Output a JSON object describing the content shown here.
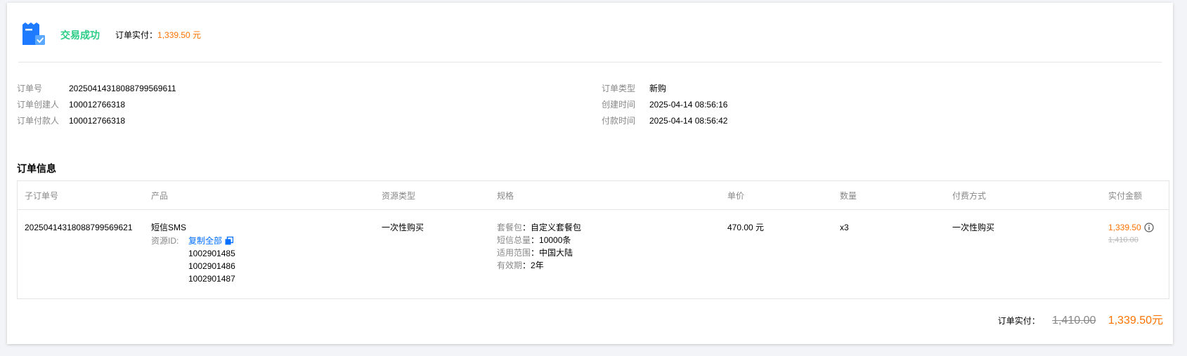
{
  "status": {
    "title": "交易成功",
    "paid_label": "订单实付：",
    "paid_amount": "1,339.50 元",
    "icon": "order-receipt-check-icon"
  },
  "meta_left": [
    {
      "label": "订单号",
      "value": "20250414318088799569611"
    },
    {
      "label": "订单创建人",
      "value": "100012766318"
    },
    {
      "label": "订单付款人",
      "value": "100012766318"
    }
  ],
  "meta_right": [
    {
      "label": "订单类型",
      "value": "新购"
    },
    {
      "label": "创建时间",
      "value": "2025-04-14 08:56:16"
    },
    {
      "label": "付款时间",
      "value": "2025-04-14 08:56:42"
    }
  ],
  "section_title": "订单信息",
  "table": {
    "headers": [
      "子订单号",
      "产品",
      "资源类型",
      "规格",
      "单价",
      "数量",
      "付费方式",
      "实付金额"
    ],
    "row": {
      "sub_order_id": "20250414318088799569621",
      "product": "短信SMS",
      "resource_id_label": "资源ID:",
      "copy_all": "复制全部",
      "resource_ids": [
        "1002901485",
        "1002901486",
        "1002901487"
      ],
      "resource_type": "一次性购买",
      "specs": [
        {
          "label": "套餐包",
          "value": "自定义套餐包"
        },
        {
          "label": "短信总量",
          "value": "10000条"
        },
        {
          "label": "适用范围",
          "value": "中国大陆"
        },
        {
          "label": "有效期",
          "value": "2年"
        }
      ],
      "unit_price": "470.00 元",
      "quantity": "x3",
      "payment_method": "一次性购买",
      "paid_amount": "1,339.50",
      "original_amount": "1,410.00"
    }
  },
  "total": {
    "label": "订单实付：",
    "original": "1,410.00",
    "final": "1,339.50元"
  },
  "colors": {
    "success": "#29cc85",
    "price": "#ff7200",
    "link": "#006eff"
  }
}
